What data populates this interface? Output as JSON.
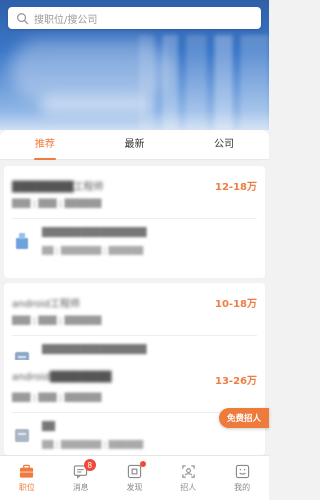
{
  "search": {
    "placeholder": "搜职位/搜公司"
  },
  "tabs": [
    {
      "label": "推荐",
      "active": true
    },
    {
      "label": "最新",
      "active": false
    },
    {
      "label": "公司",
      "active": false
    }
  ],
  "jobs": [
    {
      "title": "████████工程师",
      "salary": "12-18万",
      "meta": "███ | ███ | ██████",
      "company": "████████████████",
      "company_meta": "██ | ███████ | ██████"
    },
    {
      "title": "android工程师",
      "salary": "10-18万",
      "meta": "███ | ███ | ██████",
      "company": "████████████████",
      "company_meta": "██ | ███████ | ██████"
    },
    {
      "title": "android████████",
      "salary": "13-26万",
      "meta": "███ | ███ | ██████",
      "company": "██",
      "company_meta": "██ | ███████ | ██████"
    }
  ],
  "floating_button": {
    "label": "免费招人"
  },
  "nav": [
    {
      "label": "职位",
      "icon": "briefcase-icon",
      "active": true
    },
    {
      "label": "消息",
      "icon": "message-icon",
      "badge": "8"
    },
    {
      "label": "发现",
      "icon": "discover-icon",
      "dot": true
    },
    {
      "label": "招人",
      "icon": "recruit-icon"
    },
    {
      "label": "我的",
      "icon": "profile-icon"
    }
  ],
  "colors": {
    "accent": "#f07a3f",
    "badge": "#f04a3a",
    "banner": "#3b77c9"
  }
}
